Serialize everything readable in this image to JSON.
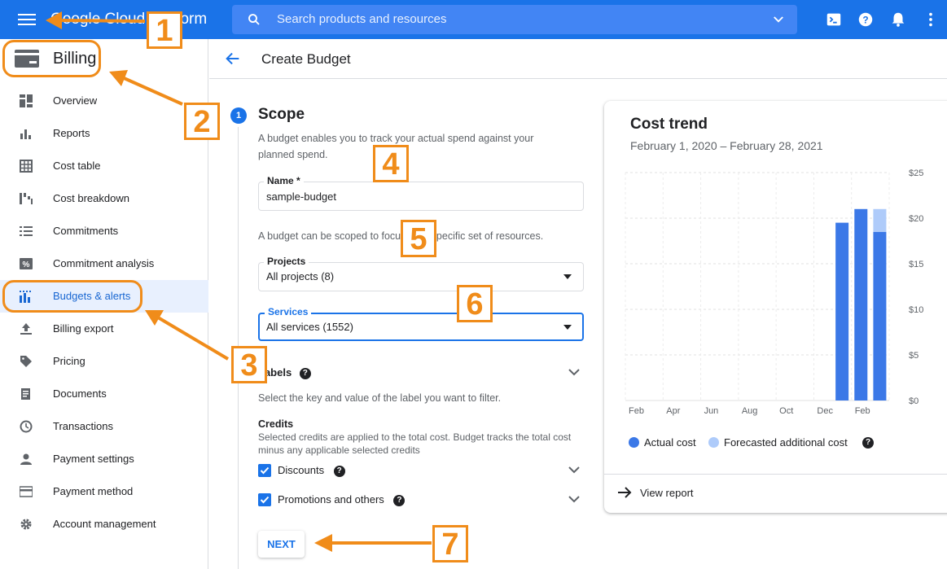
{
  "topbar": {
    "app_title": "Google Cloud Platform",
    "search_placeholder": "Search products and resources",
    "icons": [
      "menu-icon",
      "search-icon",
      "chevron-down-icon",
      "terminal-icon",
      "help-icon",
      "bell-icon",
      "more-vert-icon"
    ]
  },
  "sidebar": {
    "title": "Billing",
    "items": [
      {
        "label": "Overview",
        "icon": "dashboard-icon"
      },
      {
        "label": "Reports",
        "icon": "bar-chart-icon"
      },
      {
        "label": "Cost table",
        "icon": "table-icon"
      },
      {
        "label": "Cost breakdown",
        "icon": "waterfall-icon"
      },
      {
        "label": "Commitments",
        "icon": "list-icon"
      },
      {
        "label": "Commitment analysis",
        "icon": "percent-icon"
      },
      {
        "label": "Budgets & alerts",
        "icon": "budget-icon",
        "active": true
      },
      {
        "label": "Billing export",
        "icon": "upload-icon"
      },
      {
        "label": "Pricing",
        "icon": "tag-icon"
      },
      {
        "label": "Documents",
        "icon": "document-icon"
      },
      {
        "label": "Transactions",
        "icon": "clock-icon"
      },
      {
        "label": "Payment settings",
        "icon": "person-icon"
      },
      {
        "label": "Payment method",
        "icon": "credit-card-icon"
      },
      {
        "label": "Account management",
        "icon": "gear-icon"
      }
    ]
  },
  "main": {
    "page_title": "Create Budget",
    "step_number": "1",
    "scope_title": "Scope",
    "scope_desc_1": "A budget enables you to track your actual spend against your",
    "scope_desc_2": "planned spend.",
    "name_label": "Name *",
    "name_value": "sample-budget",
    "resources_desc": "A budget can be scoped to focus on a specific set of resources.",
    "projects_label": "Projects",
    "projects_value": "All projects (8)",
    "services_label": "Services",
    "services_value": "All services (1552)",
    "labels_title": "Labels",
    "labels_desc": "Select the key and value of the label you want to filter.",
    "credits_title": "Credits",
    "credits_desc_1": "Selected credits are applied to the total cost. Budget tracks the total cost",
    "credits_desc_2": "minus any applicable selected credits",
    "discounts_label": "Discounts",
    "discounts_checked": true,
    "promotions_label": "Promotions and others",
    "promotions_checked": true,
    "next_label": "NEXT",
    "help_glyph": "?"
  },
  "card": {
    "title": "Cost trend",
    "subtitle": "February 1, 2020 – February 28, 2021",
    "legend_actual": "Actual cost",
    "legend_forecast": "Forecasted additional cost",
    "view_report": "View report",
    "actual_color": "#3b78e7",
    "forecast_color": "#aecbfa"
  },
  "chart_data": {
    "type": "bar",
    "x_tick_labels": [
      "Feb",
      "Apr",
      "Jun",
      "Aug",
      "Oct",
      "Dec",
      "Feb"
    ],
    "y_tick_labels": [
      "$25",
      "$20",
      "$15",
      "$10",
      "$5",
      "$0"
    ],
    "ylim": [
      0,
      25
    ],
    "grid": true,
    "legend_position": "bottom",
    "series": [
      {
        "name": "Actual cost",
        "values": [
          0,
          0,
          0,
          0,
          0,
          0,
          0,
          0,
          0,
          0,
          0,
          19.5,
          21,
          18.5
        ]
      },
      {
        "name": "Forecasted additional cost",
        "values": [
          0,
          0,
          0,
          0,
          0,
          0,
          0,
          0,
          0,
          0,
          0,
          0,
          0,
          2.5
        ]
      }
    ]
  },
  "annotations": {
    "callouts": [
      "1",
      "2",
      "3",
      "4",
      "5",
      "6",
      "7"
    ],
    "color": "#f08c1a"
  }
}
